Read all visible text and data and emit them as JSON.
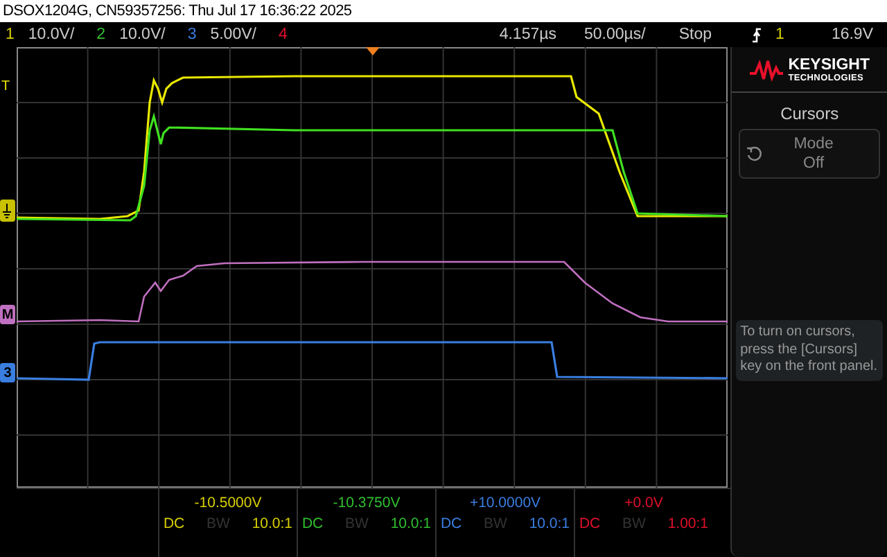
{
  "title": "DSOX1204G, CN59357256: Thu Jul 17 16:36:22 2025",
  "status_bar": {
    "channels": [
      {
        "number": "1",
        "scale": "10.0V/",
        "color": "#d8d000"
      },
      {
        "number": "2",
        "scale": "10.0V/",
        "color": "#30c030"
      },
      {
        "number": "3",
        "scale": "5.00V/",
        "color": "#3a7ee0"
      },
      {
        "number": "4",
        "color": "#e0102a"
      }
    ],
    "delay": "4.157µs",
    "timebase": "50.00µs/",
    "run_state": "Stop",
    "trigger_source": "1",
    "trigger_level": "16.9V"
  },
  "markers": [
    {
      "kind": "trigger",
      "label": "T",
      "color": "#e8e000"
    },
    {
      "kind": "ground",
      "color": "#c8c000"
    },
    {
      "kind": "math",
      "label": "M",
      "color": "#c070c0"
    },
    {
      "kind": "channel",
      "label": "3",
      "color": "#3a7ee0"
    }
  ],
  "panel": {
    "brand": "KEYSIGHT",
    "brand_sub": "TECHNOLOGIES",
    "menu_title": "Cursors",
    "softkey": {
      "label": "Mode",
      "value": "Off"
    },
    "info": "To turn on cursors, press the [Cursors] key on the front panel."
  },
  "channel_info": [
    {
      "offset": "-10.5000V",
      "coupling": "DC",
      "bw_limit": false,
      "bw": "BW",
      "probe": "10.0:1",
      "color": "#d8d000"
    },
    {
      "offset": "-10.3750V",
      "coupling": "DC",
      "bw_limit": false,
      "bw": "BW",
      "probe": "10.0:1",
      "color": "#30c030"
    },
    {
      "offset": "+10.0000V",
      "coupling": "DC",
      "bw_limit": false,
      "bw": "BW",
      "probe": "10.0:1",
      "color": "#3a7ee0"
    },
    {
      "offset": "+0.0V",
      "coupling": "DC",
      "bw_limit": false,
      "bw": "BW",
      "probe": "1.00:1",
      "color": "#e0102a"
    }
  ]
}
